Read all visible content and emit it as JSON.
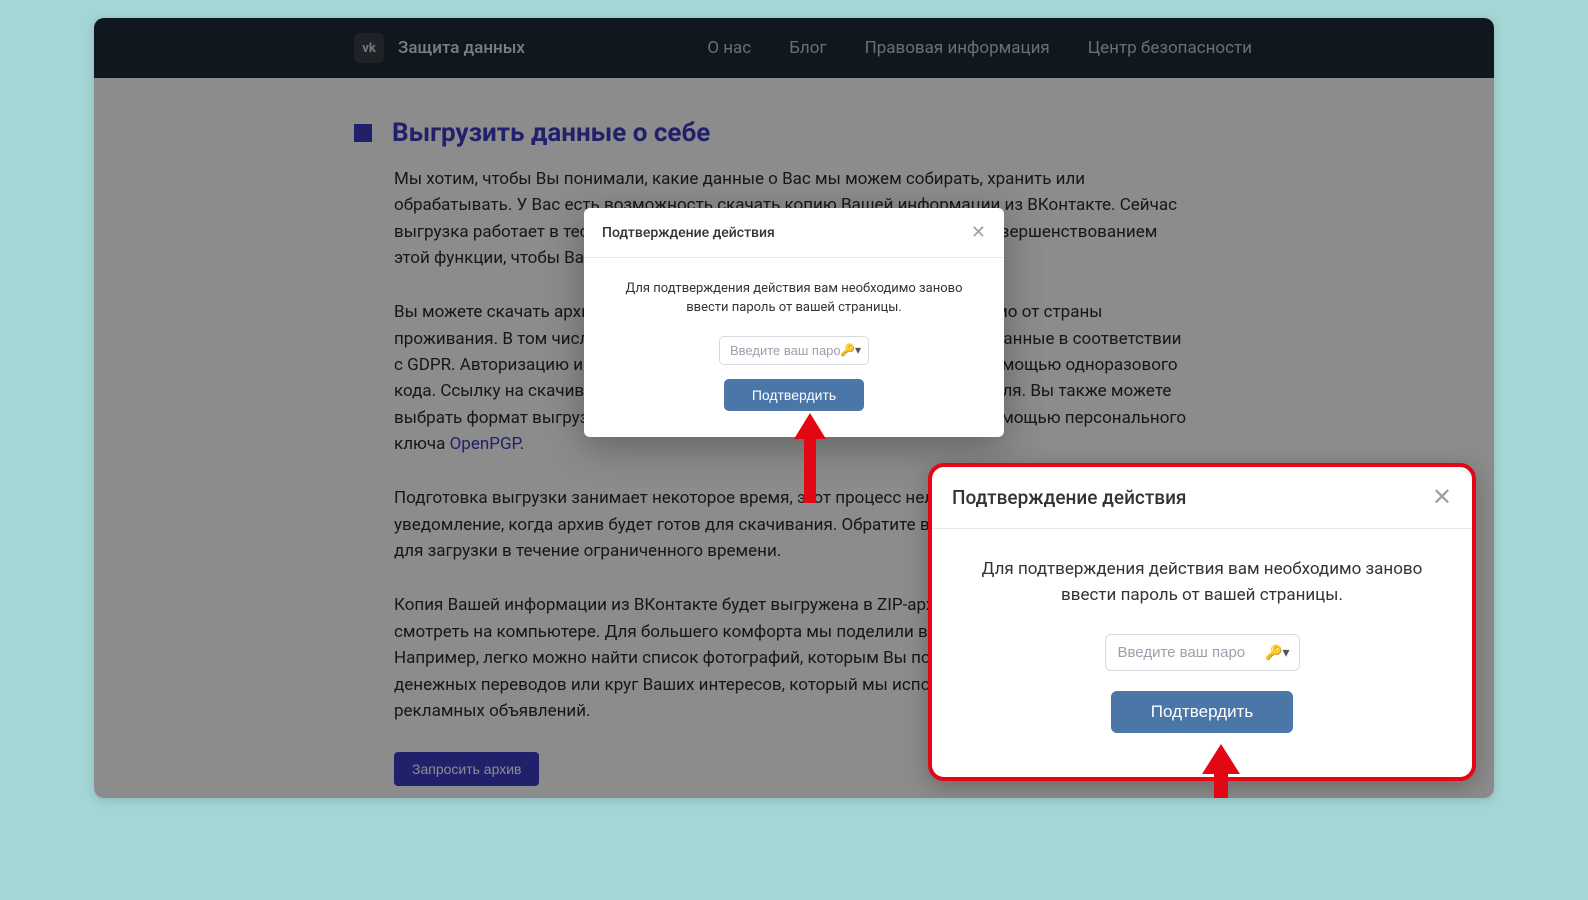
{
  "header": {
    "logo_text": "vk",
    "brand": "Защита данных",
    "nav": {
      "about": "О нас",
      "blog": "Блог",
      "legal": "Правовая информация",
      "security": "Центр безопасности"
    }
  },
  "main": {
    "title": "Выгрузить данные о себе",
    "p1": "Мы хотим, чтобы Вы понимали, какие данные о Вас мы можем собирать, хранить или обрабатывать. У Вас есть возможность скачать копию Вашей информации из ВКонтакте. Сейчас выгрузка работает в тестовом режиме — мы продолжаем работать над усовершенствованием этой функции, чтобы Вам было максимально удобно ей пользоваться.",
    "p2a": "Вы можете скачать архив с данными, которые Вы передали нам, независимо от страны проживания. В том числе, если Вы находитесь в ЕС, Вы можете запросить данные в соответствии с GDPR. Авторизацию и право владения профилем нужно подтвердить с помощью одноразового кода. Ссылку на скачивание архива невозможно открыть из другого профиля. Вы также можете выбрать формат выгрузки — онлайн или JSON — и зашифровать архив с помощью персонального ключа ",
    "p2_link": "OpenPGP",
    "p2b": ".",
    "p3": "Подготовка выгрузки занимает некоторое время, этот процесс нельзя ускорить. Вы получите уведомление, когда архив будет готов для скачивания. Обратите внимание, что он будет доступен для загрузки в течение ограниченного времени.",
    "p4": "Копия Вашей информации из ВКонтакте будет выгружена в ZIP-архив, который Вы сможете смотреть на компьютере. Для большего комфорта мы поделили все данные по категориям. Например, легко можно найти список фотографий, которым Вы поставили «Нравится», историю денежных переводов или круг Ваших интересов, который мы используем для настройки рекламных объявлений.",
    "request_button": "Запросить архив"
  },
  "dialog": {
    "title": "Подтверждение действия",
    "message": "Для подтверждения действия вам необходимо заново ввести пароль от вашей страницы.",
    "placeholder": "Введите ваш паро",
    "confirm": "Подтвердить"
  }
}
